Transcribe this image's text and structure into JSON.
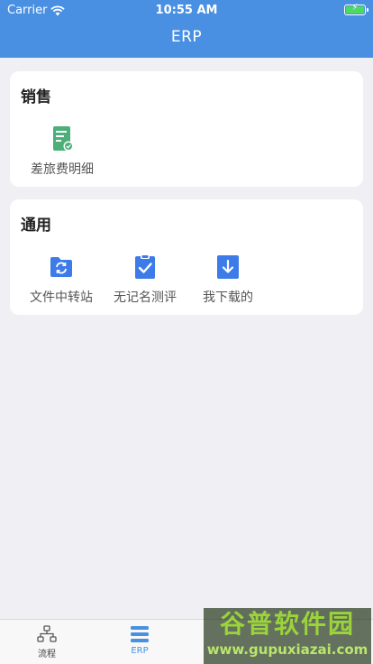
{
  "status": {
    "carrier": "Carrier",
    "time": "10:55 AM"
  },
  "nav": {
    "title": "ERP"
  },
  "sections": {
    "sales": {
      "title": "销售",
      "items": [
        {
          "label": "差旅费明细",
          "icon": "expense-doc-icon",
          "color": "#4caf7a"
        }
      ]
    },
    "general": {
      "title": "通用",
      "items": [
        {
          "label": "文件中转站",
          "icon": "folder-sync-icon",
          "color": "#3d7be8"
        },
        {
          "label": "无记名测评",
          "icon": "clipboard-check-icon",
          "color": "#3d7be8"
        },
        {
          "label": "我下载的",
          "icon": "download-icon",
          "color": "#3d7be8"
        }
      ]
    }
  },
  "tabbar": {
    "tabs": [
      {
        "label": "流程",
        "icon": "workflow-icon",
        "active": false
      },
      {
        "label": "ERP",
        "icon": "list-icon",
        "active": true
      }
    ]
  },
  "watermark": {
    "title": "谷普软件园",
    "url": "www.gupuxiazai.com"
  },
  "colors": {
    "accent": "#4a90e2",
    "background": "#efeff4"
  }
}
